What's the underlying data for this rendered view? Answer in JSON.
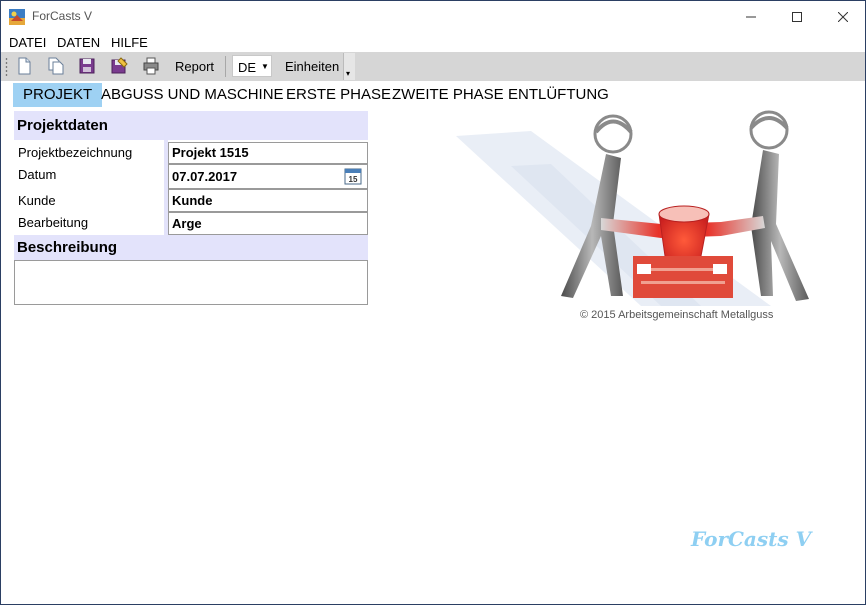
{
  "window": {
    "title": "ForCasts V"
  },
  "menu": {
    "items": [
      "DATEI",
      "DATEN",
      "HILFE"
    ]
  },
  "toolbar": {
    "icons": [
      "new-document-icon",
      "copy-document-icon",
      "save-icon",
      "save-as-icon",
      "print-icon"
    ],
    "report_label": "Report",
    "language_value": "DE",
    "units_label": "Einheiten"
  },
  "tabs": [
    "PROJEKT",
    "ABGUSS UND MASCHINE",
    "ERSTE PHASE",
    "ZWEITE PHASE",
    "ENTLÜFTUNG"
  ],
  "active_tab": "PROJEKT",
  "projektdaten": {
    "header": "Projektdaten",
    "rows": [
      {
        "label": "Projektbezeichnung",
        "value": "Projekt 1515"
      },
      {
        "label": "Datum",
        "value": "07.07.2017"
      },
      {
        "label": "Kunde",
        "value": "Kunde"
      },
      {
        "label": "Bearbeitung",
        "value": "Arge"
      }
    ],
    "calendar_day": "15"
  },
  "beschreibung": {
    "header": "Beschreibung",
    "value": ""
  },
  "illustration": {
    "copyright": "© 2015 Arbeitsgemeinschaft Metallguss"
  },
  "brand": "ForCasts V",
  "colors": {
    "active_tab": "#9ed1f3",
    "section_bg": "#e3e3fb",
    "brand": "#8ecff2",
    "molten_metal": "#e8332a"
  }
}
